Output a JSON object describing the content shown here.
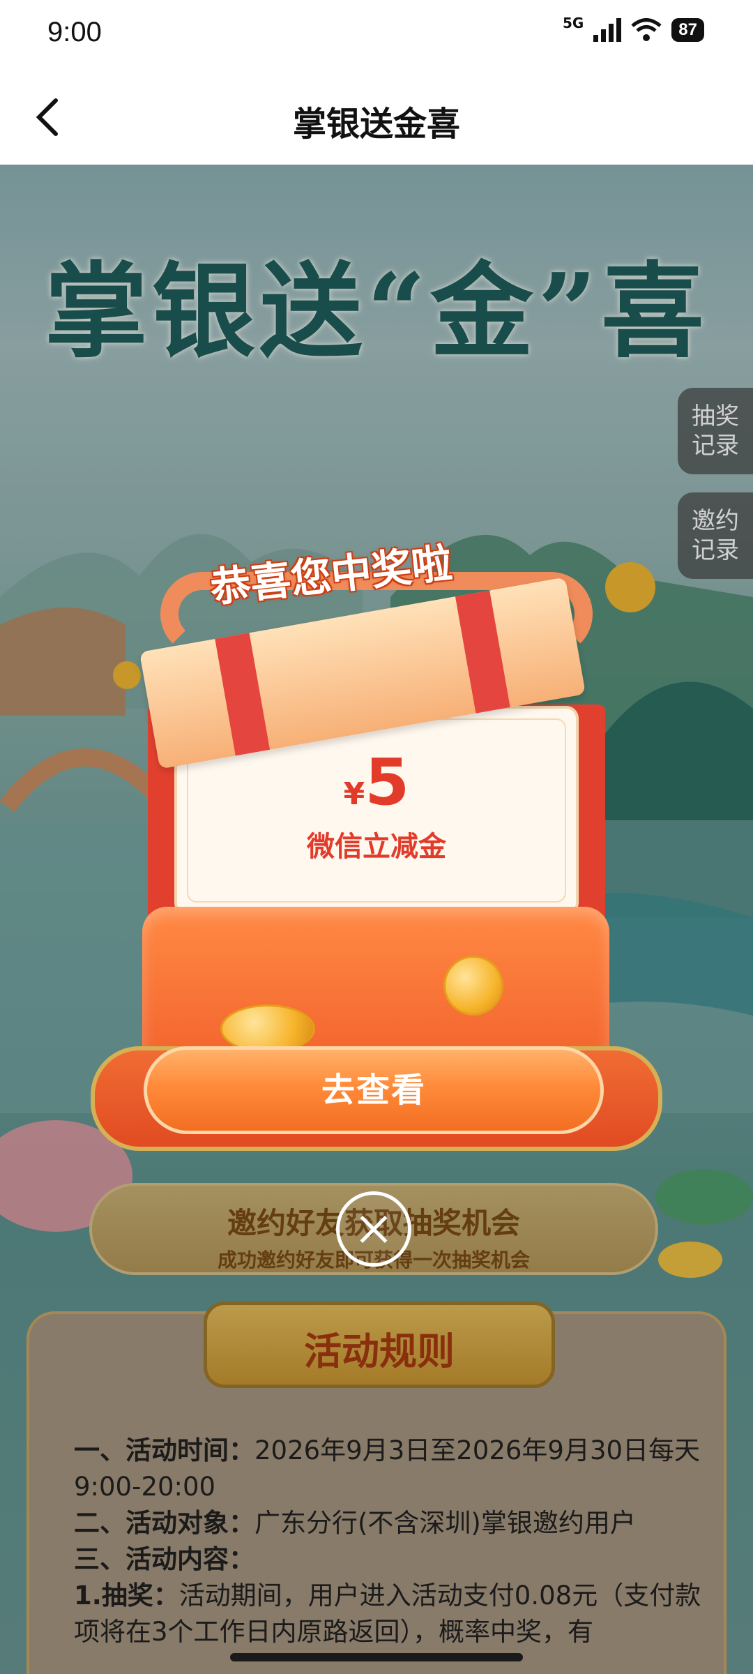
{
  "status_bar": {
    "time": "9:00",
    "network": "5G",
    "battery": "87"
  },
  "nav": {
    "title": "掌银送金喜"
  },
  "hero": {
    "title": "掌银送“金”喜"
  },
  "side_tabs": [
    {
      "line1": "抽奖",
      "line2": "记录"
    },
    {
      "line1": "邀约",
      "line2": "记录"
    }
  ],
  "modal": {
    "congrats": "恭喜您中奖啦",
    "currency_symbol": "¥",
    "amount": "5",
    "prize_name": "微信立减金",
    "view_button": "去查看"
  },
  "invite": {
    "title": "邀约好友获取抽奖机会",
    "subtitle": "成功邀约好友即可获得一次抽奖机会"
  },
  "rules": {
    "header": "活动规则",
    "item1_label": "一、活动时间：",
    "item1_text": "2026年9月3日至2026年9月30日每天9:00-20:00",
    "item2_label": "二、活动对象：",
    "item2_text": "广东分行(不含深圳)掌银邀约用户",
    "item3_label": "三、活动内容：",
    "item4_label": "1.抽奖：",
    "item4_text": "活动期间，用户进入活动支付0.08元（支付款项将在3个工作日内原路返回），概率中奖，有"
  },
  "colors": {
    "accent_orange": "#f26e22",
    "prize_red": "#e23b2a",
    "title_green": "#1f5e5c"
  }
}
